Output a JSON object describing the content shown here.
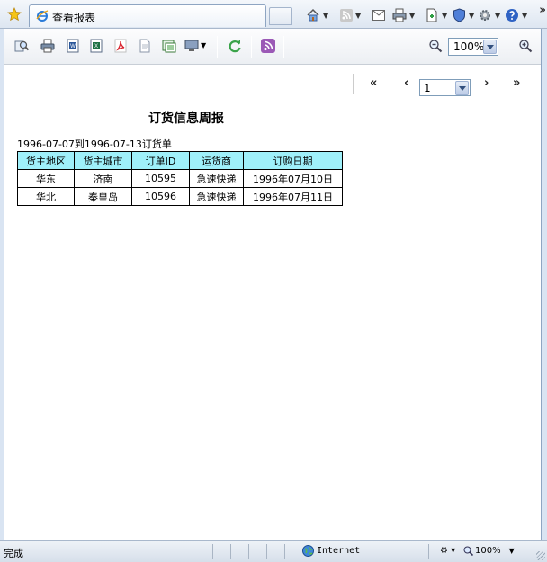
{
  "browser": {
    "tab_title": "查看报表",
    "status_text": "完成",
    "zone_label": "Internet",
    "zoom_label": "100%"
  },
  "viewer": {
    "zoom_value": "100%",
    "page_value": "1",
    "first_label": "«",
    "prev_label": "‹",
    "next_label": "›",
    "last_label": "»"
  },
  "report": {
    "title": "订货信息周报",
    "range": "1996-07-07到1996-07-13订货单",
    "columns": [
      "货主地区",
      "货主城市",
      "订单ID",
      "运货商",
      "订购日期"
    ],
    "rows": [
      [
        "华东",
        "济南",
        "10595",
        "急速快递",
        "1996年07月10日"
      ],
      [
        "华北",
        "秦皇岛",
        "10596",
        "急速快递",
        "1996年07月11日"
      ]
    ]
  },
  "colors": {
    "header_cell": "#9ff0fa",
    "chrome": "#d9e4f2"
  }
}
